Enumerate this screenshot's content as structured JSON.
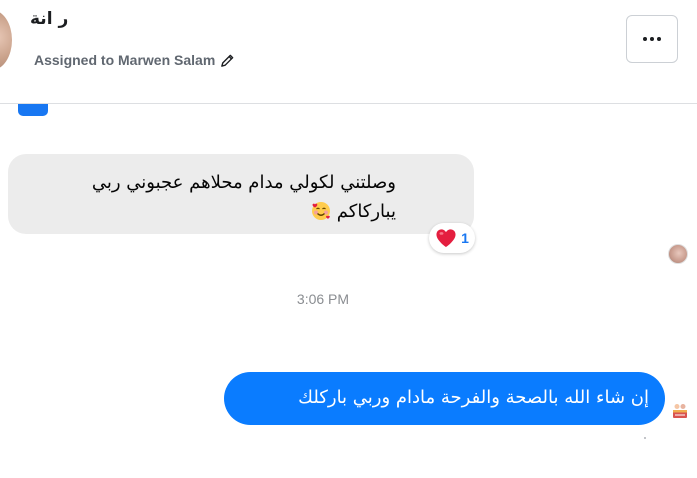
{
  "header": {
    "contact_name": "ر    انة",
    "assigned_text": "Assigned to Marwen Salam",
    "pencil_icon": "pencil-icon",
    "more_icon": "more-horizontal-icon"
  },
  "messages": {
    "incoming": {
      "text_line_1": "وصلتني لكولي مدام محلاهم عجبوني ربي",
      "text_line_2": "يباركاكم",
      "emoji": "smiling-face-with-hearts",
      "reaction": {
        "emoji": "heart",
        "count": "1"
      }
    },
    "timestamp": "3:06 PM",
    "outgoing": {
      "text": "إن شاء الله بالصحة والفرحة مادام وربي باركلك"
    }
  },
  "colors": {
    "outgoing_bubble": "#0a7cff",
    "incoming_bubble": "#ececec",
    "reaction_count": "#1877f2",
    "heart": "#e41e3f"
  }
}
